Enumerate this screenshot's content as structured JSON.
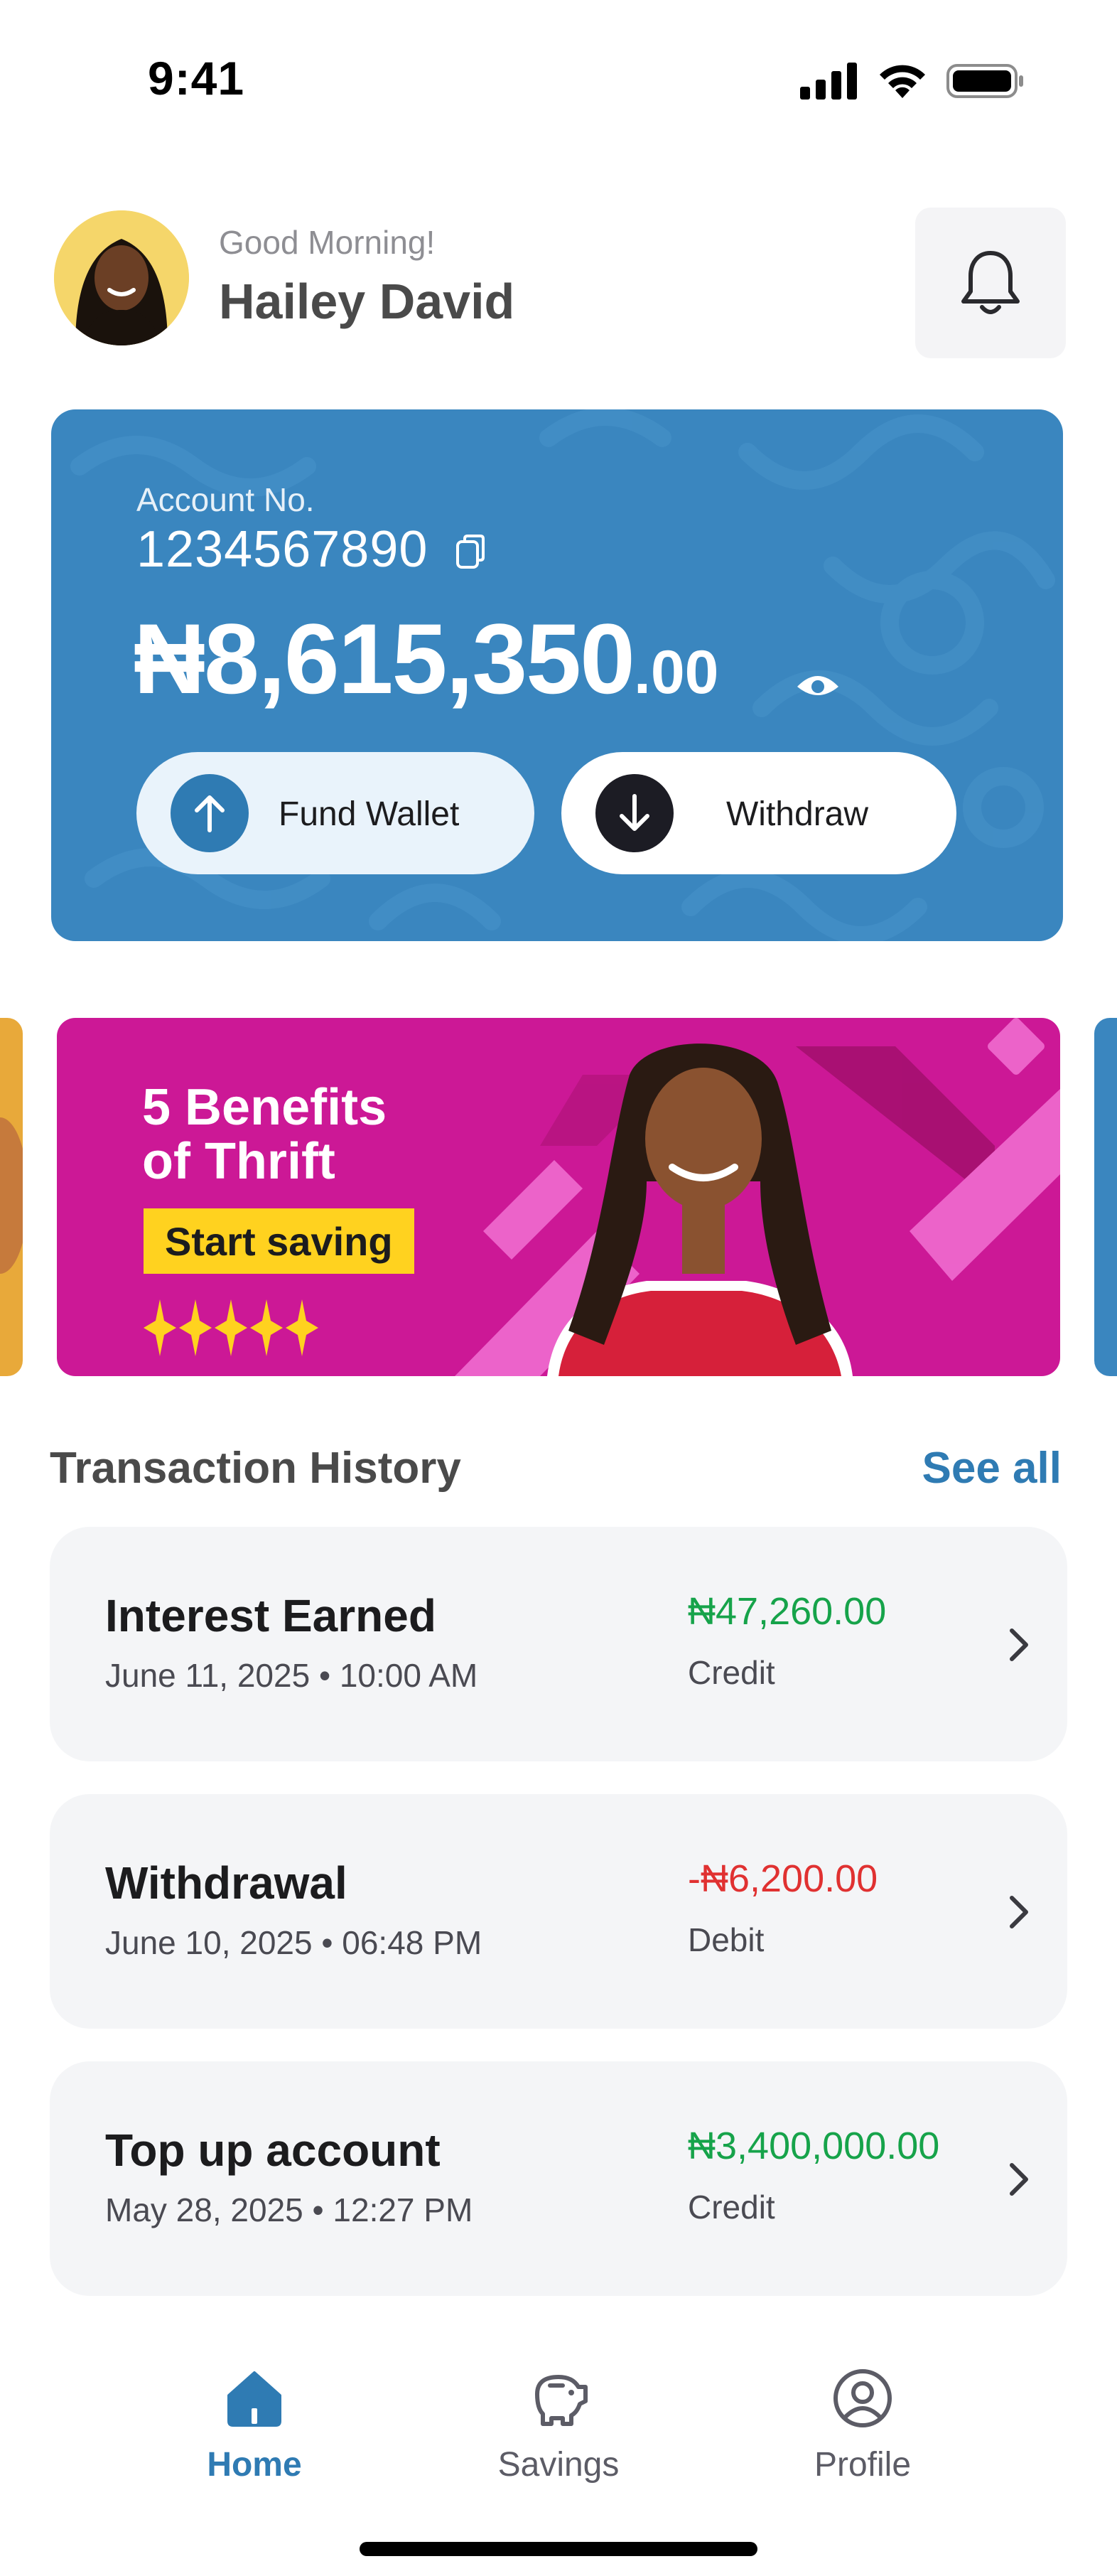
{
  "status_bar": {
    "time": "9:41"
  },
  "header": {
    "greeting": "Good Morning!",
    "user_name": "Hailey David"
  },
  "account": {
    "label": "Account No.",
    "number": "1234567890",
    "balance_main": "₦8,615,350",
    "balance_decimal": ".00",
    "fund_label": "Fund Wallet",
    "withdraw_label": "Withdraw"
  },
  "banner": {
    "title_line1": "5 Benefits",
    "title_line2": "of Thrift",
    "cta": "Start saving"
  },
  "transactions": {
    "title": "Transaction History",
    "see_all": "See all",
    "items": [
      {
        "title": "Interest Earned",
        "date": "June 11, 2025 • 10:00 AM",
        "amount": "₦47,260.00",
        "type": "Credit"
      },
      {
        "title": "Withdrawal",
        "date": "June 10, 2025 • 06:48 PM",
        "amount": "-₦6,200.00",
        "type": "Debit"
      },
      {
        "title": "Top up account",
        "date": "May 28, 2025 • 12:27 PM",
        "amount": "₦3,400,000.00",
        "type": "Credit"
      }
    ]
  },
  "nav": {
    "items": [
      {
        "label": "Home",
        "icon": "home-icon"
      },
      {
        "label": "Savings",
        "icon": "piggy-bank-icon"
      },
      {
        "label": "Profile",
        "icon": "user-icon"
      }
    ],
    "active": "Home"
  },
  "colors": {
    "primary": "#3a86bf",
    "accent": "#2f7bb3",
    "credit": "#16a34a",
    "debit": "#e03131",
    "banner": "#cc1896",
    "banner_cta": "#ffd21f"
  }
}
